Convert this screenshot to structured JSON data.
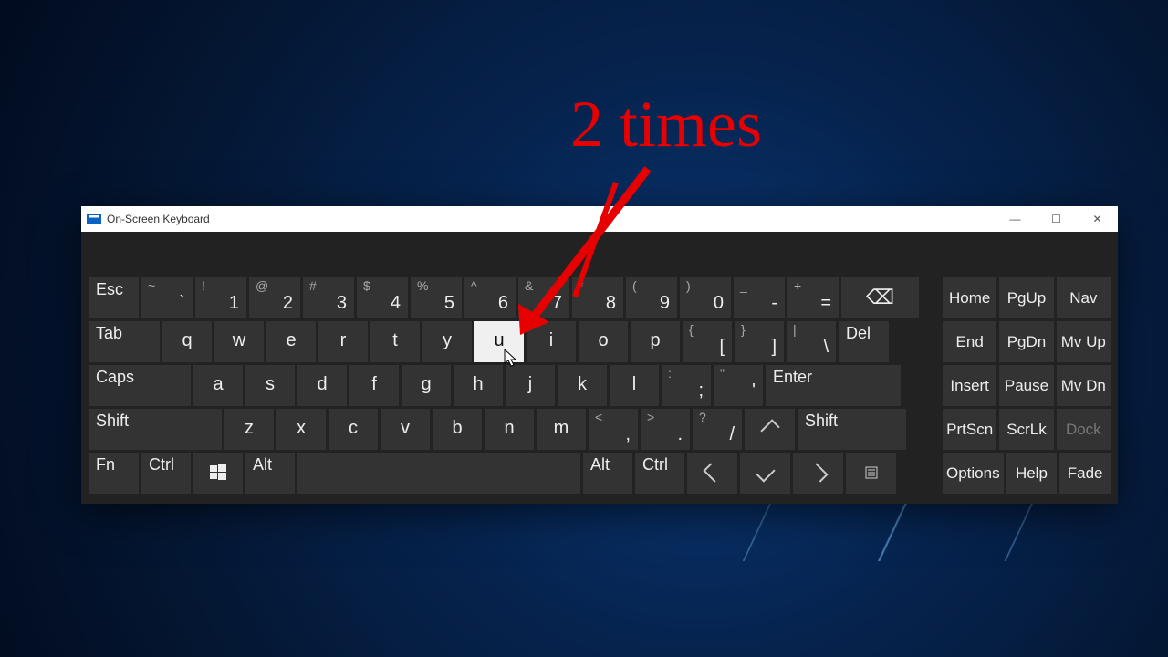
{
  "window": {
    "title": "On-Screen Keyboard"
  },
  "annotation": {
    "text": "2 times"
  },
  "rows": {
    "r1": {
      "esc": "Esc",
      "keys": [
        {
          "s": "~",
          "m": "`"
        },
        {
          "s": "!",
          "m": "1"
        },
        {
          "s": "@",
          "m": "2"
        },
        {
          "s": "#",
          "m": "3"
        },
        {
          "s": "$",
          "m": "4"
        },
        {
          "s": "%",
          "m": "5"
        },
        {
          "s": "^",
          "m": "6"
        },
        {
          "s": "&",
          "m": "7"
        },
        {
          "s": "*",
          "m": "8"
        },
        {
          "s": "(",
          "m": "9"
        },
        {
          "s": ")",
          "m": "0"
        },
        {
          "s": "_",
          "m": "-"
        },
        {
          "s": "+",
          "m": "="
        }
      ],
      "bksp_icon": "⌫"
    },
    "r2": {
      "tab": "Tab",
      "letters": [
        "q",
        "w",
        "e",
        "r",
        "t",
        "y",
        "u",
        "i",
        "o",
        "p"
      ],
      "punct": [
        {
          "s": "{",
          "m": "["
        },
        {
          "s": "}",
          "m": "]"
        },
        {
          "s": "|",
          "m": "\\"
        }
      ],
      "del": "Del"
    },
    "r3": {
      "caps": "Caps",
      "letters": [
        "a",
        "s",
        "d",
        "f",
        "g",
        "h",
        "j",
        "k",
        "l"
      ],
      "punct": [
        {
          "s": ":",
          "m": ";"
        },
        {
          "s": "\"",
          "m": "'"
        }
      ],
      "enter": "Enter"
    },
    "r4": {
      "shiftL": "Shift",
      "letters": [
        "z",
        "x",
        "c",
        "v",
        "b",
        "n",
        "m"
      ],
      "punct": [
        {
          "s": "<",
          "m": ","
        },
        {
          "s": ">",
          "m": "."
        },
        {
          "s": "?",
          "m": "/"
        }
      ],
      "shiftR": "Shift"
    },
    "r5": {
      "fn": "Fn",
      "ctrl": "Ctrl",
      "alt": "Alt",
      "altR": "Alt",
      "ctrlR": "Ctrl"
    }
  },
  "side": {
    "r1": [
      "Home",
      "PgUp",
      "Nav"
    ],
    "r2": [
      "End",
      "PgDn",
      "Mv Up"
    ],
    "r3": [
      "Insert",
      "Pause",
      "Mv Dn"
    ],
    "r4": [
      "PrtScn",
      "ScrLk",
      "Dock"
    ],
    "r5": [
      "Options",
      "Help",
      "Fade"
    ]
  },
  "highlighted_key": "u"
}
